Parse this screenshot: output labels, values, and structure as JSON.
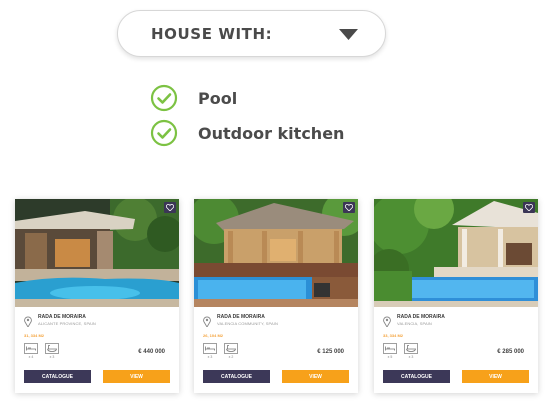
{
  "filter": {
    "dropdown_label": "HOUSE WITH:",
    "options": [
      {
        "label": "Pool",
        "checked": true
      },
      {
        "label": "Outdoor kitchen",
        "checked": true
      }
    ]
  },
  "colors": {
    "check_green": "#7cc243",
    "catalogue_button": "#3c3858",
    "view_button": "#f7a11a",
    "size_text": "#f4a23a"
  },
  "cards": [
    {
      "title": "RADA DE MORAIRA",
      "location": "ALICANTE PROVINCE, SPAIN",
      "size": "31, 334 M2",
      "feature_1_count": "x 4",
      "feature_2_count": "x 3",
      "price": "€ 440 000",
      "catalogue_label": "CATALOGUE",
      "view_label": "VIEW"
    },
    {
      "title": "RADA DE MORAIRA",
      "location": "VALENCIA COMMUNITY, SPAIN",
      "size": "26, 104 M2",
      "feature_1_count": "x 3",
      "feature_2_count": "x 2",
      "price": "€ 125 000",
      "catalogue_label": "CATALOGUE",
      "view_label": "VIEW"
    },
    {
      "title": "RADA DE MORAIRA",
      "location": "VALENCIA, SPAIN",
      "size": "33, 334 M2",
      "feature_1_count": "x 5",
      "feature_2_count": "x 3",
      "price": "€ 285 000",
      "catalogue_label": "CATALOGUE",
      "view_label": "VIEW"
    }
  ],
  "icons": {
    "dropdown": "chevron-down-icon",
    "option": "check-circle-icon",
    "favorite": "heart-icon",
    "location": "location-pin-icon",
    "feature_1": "bed-icon",
    "feature_2": "bath-icon"
  }
}
